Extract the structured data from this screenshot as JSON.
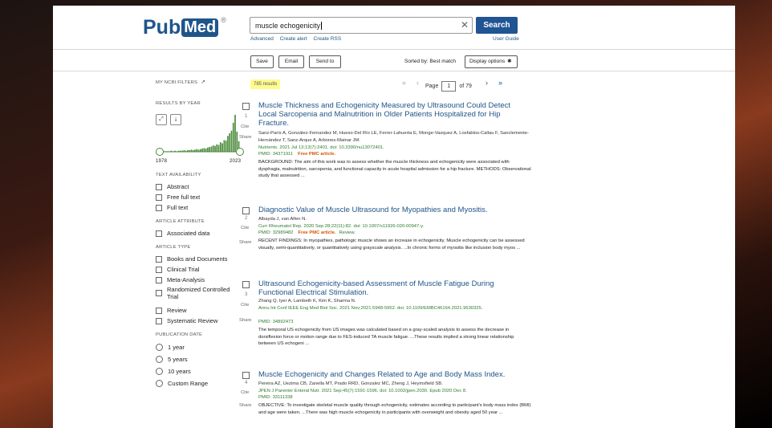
{
  "logo": {
    "pre": "Pub",
    "med": "Med",
    "reg": "®"
  },
  "search": {
    "query": "muscle echogenicity",
    "button": "Search",
    "advanced": "Advanced",
    "create_alert": "Create alert",
    "create_rss": "Create RSS",
    "user_guide": "User Guide"
  },
  "actions": {
    "save": "Save",
    "email": "Email",
    "send_to": "Send to",
    "sorted": "Sorted by: Best match",
    "display": "Display options"
  },
  "sidebar": {
    "filters": "MY NCBI FILTERS",
    "by_year": "RESULTS BY YEAR",
    "year_start": "1978",
    "year_end": "2023",
    "year_counts": [
      1,
      1,
      1,
      1,
      1,
      1,
      2,
      1,
      2,
      1,
      2,
      2,
      2,
      3,
      2,
      3,
      3,
      4,
      3,
      4,
      5,
      4,
      5,
      6,
      7,
      6,
      8,
      9,
      10,
      12,
      11,
      14,
      13,
      18,
      16,
      22,
      21,
      30,
      35,
      40,
      55,
      70,
      38,
      20
    ],
    "text_avail": "TEXT AVAILABILITY",
    "text_items": [
      "Abstract",
      "Free full text",
      "Full text"
    ],
    "attr_head": "ARTICLE ATTRIBUTE",
    "attr_items": [
      "Associated data"
    ],
    "type_head": "ARTICLE TYPE",
    "type_items": [
      "Books and Documents",
      "Clinical Trial",
      "Meta-Analysis",
      "Randomized Controlled Trial",
      "Review",
      "Systematic Review"
    ],
    "date_head": "PUBLICATION DATE",
    "date_items": [
      "1 year",
      "5 years",
      "10 years",
      "Custom Range"
    ]
  },
  "results": {
    "count": "785 results",
    "page_label": "Page",
    "page": "1",
    "of": "of 79",
    "articles": [
      {
        "num": "1",
        "title": "Muscle Thickness and Echogenicity Measured by Ultrasound Could Detect Local Sarcopenia and Malnutrition in Older Patients Hospitalized for Hip Fracture.",
        "authors": "Sanz-París A, González-Fernandez M, Hueso-Del Río LE, Ferrer-Lahuerta E, Monge-Vazquez A, Losfablos-Callau F, Sanclemente-Hernández T, Sanz-Arque A, Arbones-Mainar JM.",
        "journal": "Nutrients. 2021 Jul 13;13(7):2401. doi: 10.3390/nu13072401.",
        "pmid": "PMID: 34371911",
        "free": "Free PMC article.",
        "review": "",
        "snippet": "BACKGROUND: The aim of this work was to assess whether the muscle thickness and echogenicity were associated with dysphagia, malnutrition, sarcopenia, and functional capacity in acute hospital admission for a hip fracture. METHODS: Observational study that assessed ..."
      },
      {
        "num": "2",
        "title": "Diagnostic Value of Muscle Ultrasound for Myopathies and Myositis.",
        "authors": "Albayda J, van Alfen N.",
        "journal": "Curr Rheumatol Rep. 2020 Sep 28;22(11):82. doi: 10.1007/s11926-020-00947-y.",
        "pmid": "PMID: 32989482",
        "free": "Free PMC article.",
        "review": "Review.",
        "snippet": "RECENT FINDINGS: In myopathies, pathologic muscle shows an increase in echogenicity. Muscle echogenicity can be assessed visually, semi-quantitatively, or quantitatively using grayscale analysis. ...In chronic forms of myositis like inclusion body myos ..."
      },
      {
        "num": "3",
        "title": "Ultrasound Echogenicity-based Assessment of Muscle Fatigue During Functional Electrical Stimulation.",
        "authors": "Zhang Q, Iyer A, Lambeth K, Kim K, Sharma N.",
        "journal": "Annu Int Conf IEEE Eng Med Biol Soc. 2021 Nov;2021:5948-5952. doi: 10.1109/EMBC46164.2021.9630325.",
        "pmid": "PMID: 34892473",
        "free": "",
        "review": "",
        "snippet": "The temporal US echogenicity from US images was calculated based on a gray-scaled analysis to assess the decrease in dorsiflexion force or motion range due to FES-induced TA muscle fatigue. ...These results implied a strong linear relationship between US echogeni ..."
      },
      {
        "num": "4",
        "title": "Muscle Echogenicity and Changes Related to Age and Body Mass Index.",
        "authors": "Pereira AZ, Uezima CB, Zanella MT, Prado RRD, Gonzalez MC, Zheng J, Heymsfield SB.",
        "journal": "JPEN J Parenter Enteral Nutr. 2021 Sep;45(7):1591-1596. doi: 10.1002/jpen.2030. Epub 2020 Dec 8.",
        "pmid": "PMID: 33111338",
        "free": "",
        "review": "",
        "snippet": "OBJECTIVE: To investigate skeletal muscle quality through echogenicity, estimates according to participant's body mass index (BMI) and age were taken. ...There was high muscle echogenicity in participants with overweight and obesity aged 50 year ..."
      }
    ],
    "cite": "Cite",
    "share": "Share"
  }
}
